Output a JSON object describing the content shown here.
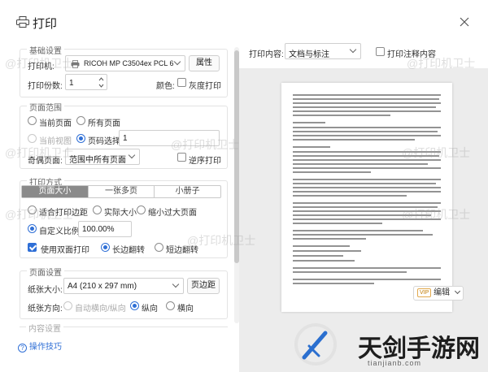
{
  "window": {
    "title": "打印"
  },
  "basic": {
    "legend": "基础设置",
    "printer_label": "打印机:",
    "printer_value": "RICOH MP C3504ex PCL 6",
    "properties_button": "属性",
    "copies_label": "打印份数:",
    "copies_value": "1",
    "color_label": "颜色:",
    "grayscale_label": "灰度打印"
  },
  "range": {
    "legend": "页面范围",
    "current_page": "当前页面",
    "all_pages": "所有页面",
    "current_view": "当前视图",
    "page_select": "页码选择:",
    "page_select_value": "1",
    "odd_even_label": "奇偶页面:",
    "odd_even_value": "范围中所有页面",
    "reverse_label": "逆序打印"
  },
  "method": {
    "legend": "打印方式",
    "tabs": [
      "页面大小",
      "一张多页",
      "小册子"
    ],
    "fit_margin": "适合打印边距",
    "actual_size": "实际大小",
    "shrink_large": "缩小过大页面",
    "custom_scale": "自定义比例",
    "custom_scale_value": "100.00%",
    "duplex_label": "使用双面打印",
    "long_edge": "长边翻转",
    "short_edge": "短边翻转"
  },
  "page_setup": {
    "legend": "页面设置",
    "paper_size_label": "纸张大小:",
    "paper_size_value": "A4 (210 x 297 mm)",
    "margin_button": "页边距",
    "orientation_label": "纸张方向:",
    "auto_orientation": "自动横向/纵向",
    "portrait": "纵向",
    "landscape": "横向"
  },
  "content_legend": "内容设置",
  "help_link": "操作技巧",
  "preview": {
    "content_label": "打印内容:",
    "content_value": "文档与标注",
    "annotations_label": "打印注释内容",
    "edit_button": "编辑",
    "vip_badge": "VIP"
  },
  "watermark": "@打印机卫士",
  "brand": {
    "name": "天剑手游网",
    "url": "tianjianb.com"
  },
  "colors": {
    "accent": "#2f6fd6",
    "active_tab": "#8a8a8a",
    "preview_bg": "#ececec"
  }
}
